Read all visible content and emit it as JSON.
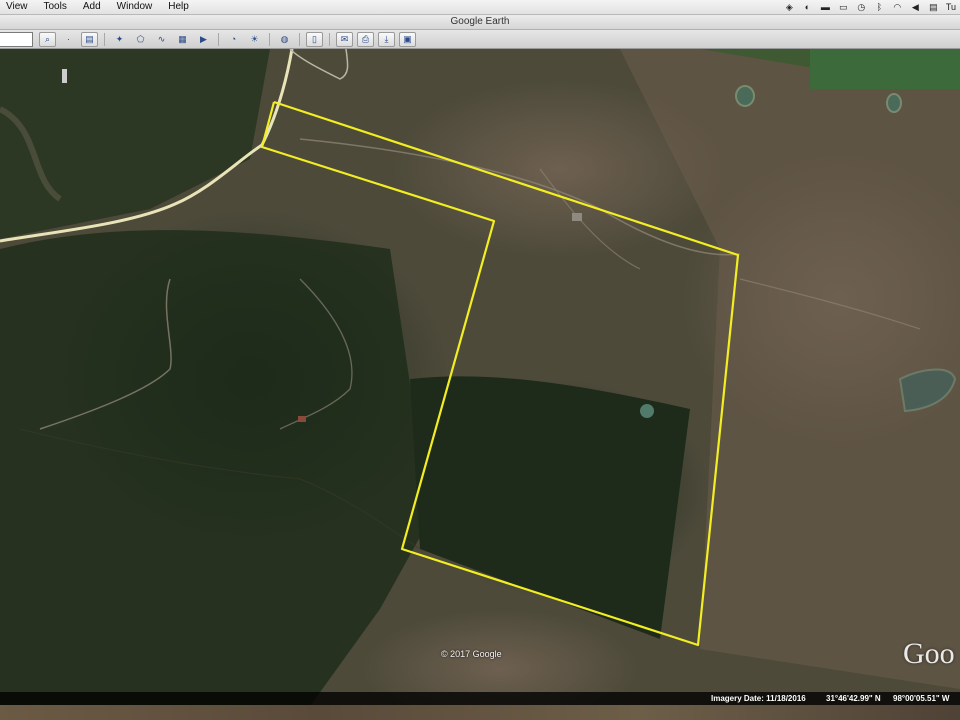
{
  "menubar": {
    "items": [
      "View",
      "Tools",
      "Add",
      "Window",
      "Help"
    ],
    "clock": "Tu"
  },
  "window": {
    "title": "Google Earth"
  },
  "toolbar": {
    "buttons": [
      {
        "icon": "search-icon"
      },
      {
        "icon": "sidebar-icon"
      },
      {
        "icon": "placemark-icon"
      },
      {
        "icon": "polygon-icon"
      },
      {
        "icon": "path-icon"
      },
      {
        "icon": "image-overlay-icon"
      },
      {
        "icon": "tour-icon"
      },
      {
        "icon": "historical-imagery-icon"
      },
      {
        "icon": "sunlight-icon"
      },
      {
        "icon": "planet-icon"
      },
      {
        "icon": "ruler-icon"
      },
      {
        "icon": "email-icon"
      },
      {
        "icon": "print-icon"
      },
      {
        "icon": "save-image-icon"
      },
      {
        "icon": "maps-icon"
      }
    ]
  },
  "map": {
    "copyright": "© 2017 Google",
    "logo": "Goo",
    "boundary_color": "#f2ee22",
    "road_color": "#e8e4b8"
  },
  "status": {
    "imagery_date": "Imagery Date: 11/18/2016",
    "lat": "31°46'42.99\" N",
    "lon": "98°00'05.51\" W"
  }
}
